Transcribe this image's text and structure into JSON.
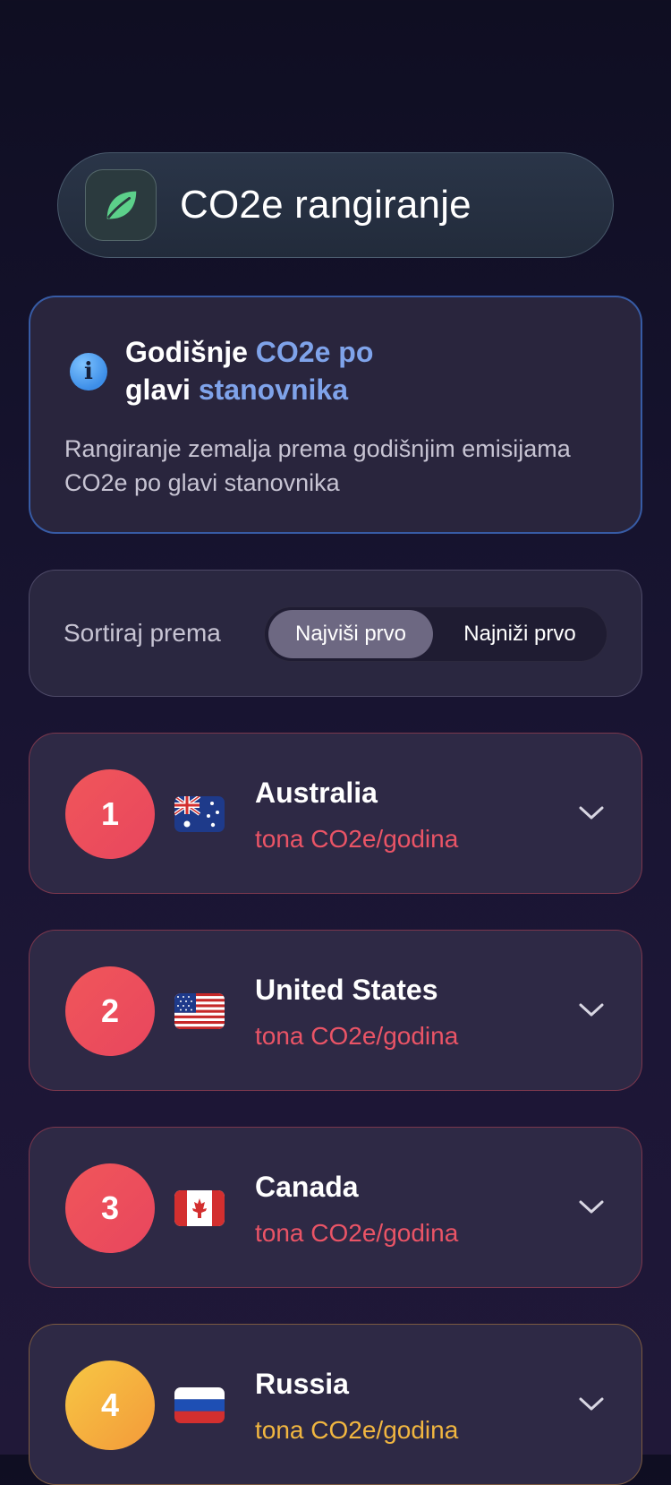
{
  "header": {
    "title": "CO2e rangiranje",
    "icon": "leaf-icon"
  },
  "info": {
    "title_part1": "Godišnje ",
    "title_highlight1": "CO2e po",
    "title_part2": "glavi ",
    "title_highlight2": "stanovnika",
    "description": "Rangiranje zemalja prema godišnjim emisijama CO2e po glavi stanovnika",
    "icon": "info-icon"
  },
  "sort": {
    "label": "Sortiraj prema",
    "options": [
      "Najviši prvo",
      "Najniži prvo"
    ],
    "selected": "Najviši prvo"
  },
  "countries": [
    {
      "rank": "1",
      "name": "Australia",
      "unit": "tona CO2e/godina",
      "flag": "australia-flag"
    },
    {
      "rank": "2",
      "name": "United States",
      "unit": "tona CO2e/godina",
      "flag": "usa-flag"
    },
    {
      "rank": "3",
      "name": "Canada",
      "unit": "tona CO2e/godina",
      "flag": "canada-flag"
    },
    {
      "rank": "4",
      "name": "Russia",
      "unit": "tona CO2e/godina",
      "flag": "russia-flag"
    }
  ],
  "colors": {
    "accent_red": "#ea5466",
    "accent_orange": "#f1b640",
    "highlight_blue": "#7fa3ea"
  }
}
